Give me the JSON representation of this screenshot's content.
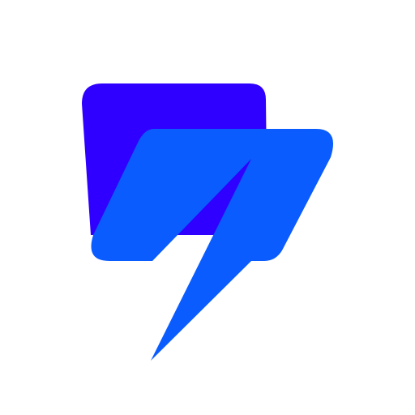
{
  "image": {
    "background_color": "#ffffff"
  },
  "logo": {
    "name": "chat-lightning-logo",
    "colors": {
      "back_shape": "#2f00ff",
      "front_shape": "#0a5cff"
    }
  }
}
